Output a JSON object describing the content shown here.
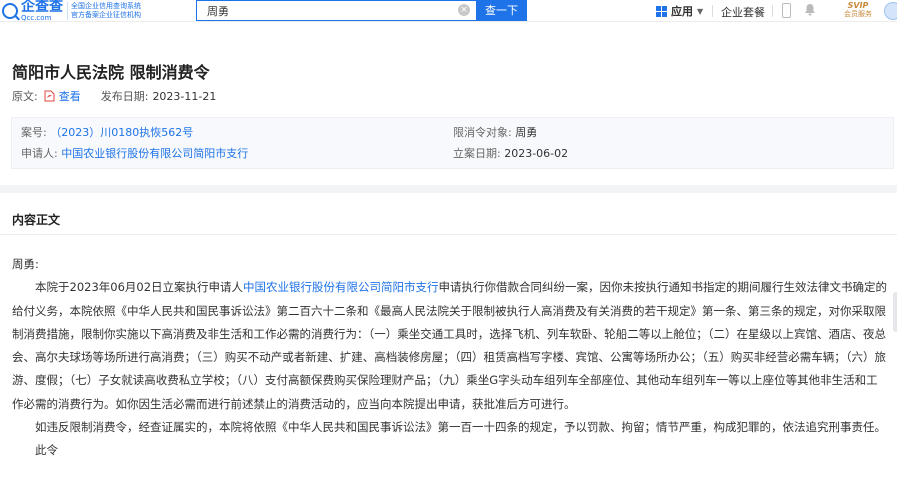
{
  "header": {
    "logo_cn": "企查查",
    "logo_en": "Qcc.com",
    "logo_sub_1": "全国企业信用查询系统",
    "logo_sub_2": "官方备案企业征信机构",
    "search_value": "周勇",
    "search_button": "查一下",
    "apps_label": "应用",
    "package_label": "企业套餐",
    "svip_top": "SVIP",
    "svip_bottom": "会员服务"
  },
  "document": {
    "title": "简阳市人民法院 限制消费令",
    "original_label": "原文:",
    "view_link": "查看",
    "publish_date_label": "发布日期:",
    "publish_date": "2023-11-21"
  },
  "info": {
    "case_no_label": "案号:",
    "case_no": "（2023）川0180执恢562号",
    "restricted_label": "限消令对象:",
    "restricted": "周勇",
    "applicant_label": "申请人:",
    "applicant": "中国农业银行股份有限公司简阳市支行",
    "filing_date_label": "立案日期:",
    "filing_date": "2023-06-02"
  },
  "content": {
    "section_title": "内容正文",
    "salutation": "周勇:",
    "p1_before": "本院于2023年06月02日立案执行申请人",
    "p1_link": "中国农业银行股份有限公司简阳市支行",
    "p1_after": "申请执行你借款合同纠纷一案，因你未按执行通知书指定的期间履行生效法律文书确定的给付义务，本院依照《中华人民共和国民事诉讼法》第二百六十二条和《最高人民法院关于限制被执行人高消费及有关消费的若干规定》第一条、第三条的规定，对你采取限制消费措施，限制你实施以下高消费及非生活和工作必需的消费行为：（一）乘坐交通工具时，选择飞机、列车软卧、轮船二等以上舱位；（二）在星级以上宾馆、酒店、夜总会、高尔夫球场等场所进行高消费；（三）购买不动产或者新建、扩建、高档装修房屋；（四）租赁高档写字楼、宾馆、公寓等场所办公；（五）购买非经营必需车辆；（六）旅游、度假；（七）子女就读高收费私立学校；（八）支付高额保费购买保险理财产品；（九）乘坐G字头动车组列车全部座位、其他动车组列车一等以上座位等其他非生活和工作必需的消费行为。如你因生活必需而进行前述禁止的消费活动的，应当向本院提出申请，获批准后方可进行。",
    "p2": "如违反限制消费令，经查证属实的，本院将依照《中华人民共和国民事诉讼法》第一百一十四条的规定，予以罚款、拘留；情节严重，构成犯罪的，依法追究刑事责任。",
    "p3": "此令"
  },
  "colors": {
    "brand_blue": "#1e73e8"
  }
}
